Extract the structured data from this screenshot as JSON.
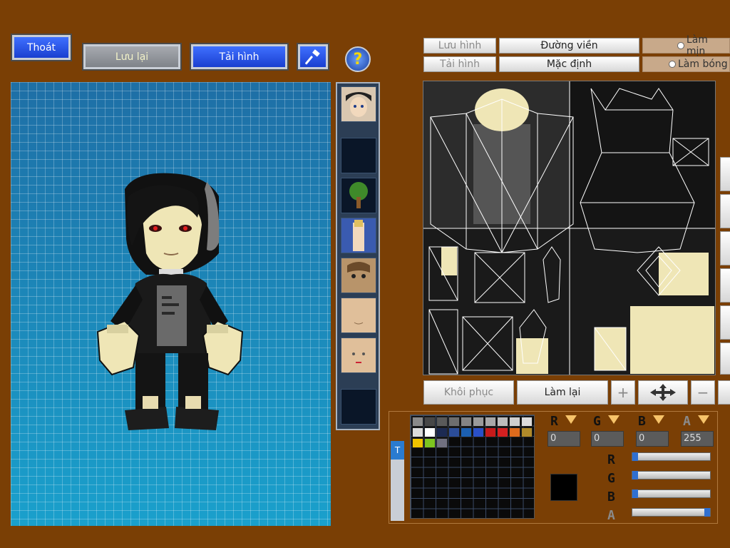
{
  "toolbar": {
    "exit_label": "Thoát",
    "save_label": "Lưu lại",
    "load_label": "Tải hình",
    "help_glyph": "?"
  },
  "uv_controls": {
    "save_image_label": "Lưu hình",
    "load_image_label": "Tải hình",
    "outline_label": "Đường viền",
    "default_label": "Mặc định",
    "smooth_label": "Làm mịn",
    "shade_label": "Làm bóng"
  },
  "edit_controls": {
    "restore_label": "Khôi phục",
    "redo_label": "Làm lại",
    "zoom_in_glyph": "+",
    "zoom_out_glyph": "−"
  },
  "color": {
    "r_label": "R",
    "g_label": "G",
    "b_label": "B",
    "a_label": "A",
    "r_value": "0",
    "g_value": "0",
    "b_value": "0",
    "a_value": "255",
    "tab_label": "T",
    "preview_hex": "#000000",
    "sliders": {
      "r": 0,
      "g": 0,
      "b": 0,
      "a": 255
    },
    "palette": [
      "#8a8a8a",
      "#474747",
      "#5a5a5a",
      "#6e6e6e",
      "#858585",
      "#9a9a9a",
      "#a8a8a8",
      "#bcbcbc",
      "#cfcfcf",
      "#dcdcdc",
      "#dcdcdc",
      "#ffffff",
      "#1c2a52",
      "#2b4d99",
      "#1b5fb0",
      "#2a50c7",
      "#c61a1a",
      "#d42020",
      "#dc6a1c",
      "#b08a2a",
      "#f0c400",
      "#7dc520",
      "#707080"
    ]
  },
  "parts": [
    {
      "name": "part-head-icon"
    },
    {
      "name": "part-empty-slot-1-icon"
    },
    {
      "name": "part-tree-icon"
    },
    {
      "name": "part-body-icon"
    },
    {
      "name": "part-face-1-icon"
    },
    {
      "name": "part-face-2-icon"
    },
    {
      "name": "part-face-3-icon"
    },
    {
      "name": "part-empty-slot-2-icon"
    }
  ]
}
